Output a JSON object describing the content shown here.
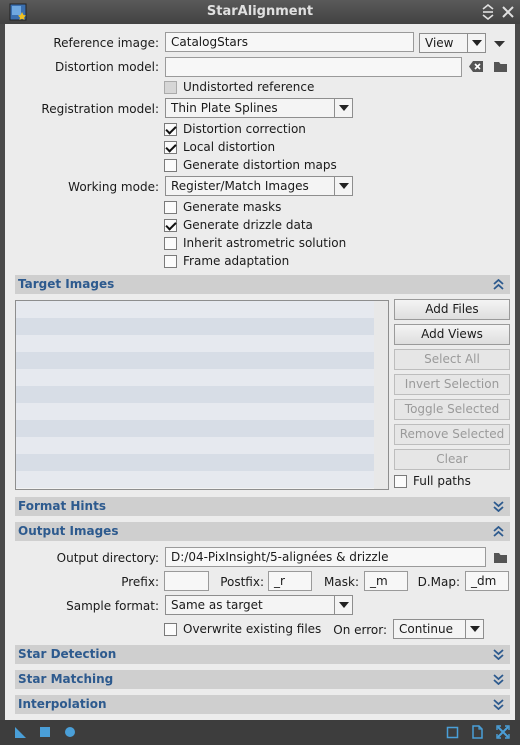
{
  "window": {
    "title": "StarAlignment"
  },
  "reference": {
    "label": "Reference image:",
    "value": "CatalogStars",
    "view_option": "View",
    "distortion_label": "Distortion model:",
    "distortion_value": "",
    "undistorted_label": "Undistorted reference"
  },
  "registration": {
    "label": "Registration model:",
    "value": "Thin Plate Splines",
    "distortion_correction": "Distortion correction",
    "local_distortion": "Local distortion",
    "generate_distortion_maps": "Generate distortion maps"
  },
  "working": {
    "label": "Working mode:",
    "value": "Register/Match Images",
    "generate_masks": "Generate masks",
    "generate_drizzle": "Generate drizzle data",
    "inherit_astrometric": "Inherit astrometric solution",
    "frame_adaptation": "Frame adaptation"
  },
  "targets": {
    "title": "Target Images",
    "buttons": [
      "Add Files",
      "Add Views",
      "Select All",
      "Invert Selection",
      "Toggle Selected",
      "Remove Selected",
      "Clear"
    ],
    "full_paths": "Full paths"
  },
  "format_hints": {
    "title": "Format Hints"
  },
  "output": {
    "title": "Output Images",
    "dir_label": "Output directory:",
    "dir_value": "D:/04-PixInsight/5-alignées & drizzle",
    "prefix_label": "Prefix:",
    "prefix_value": "",
    "postfix_label": "Postfix:",
    "postfix_value": "_r",
    "mask_label": "Mask:",
    "mask_value": "_m",
    "dmap_label": "D.Map:",
    "dmap_value": "_dm",
    "sample_label": "Sample format:",
    "sample_value": "Same as target",
    "overwrite_label": "Overwrite existing files",
    "onerror_label": "On error:",
    "onerror_value": "Continue"
  },
  "sections": {
    "star_detection": "Star Detection",
    "star_matching": "Star Matching",
    "interpolation": "Interpolation"
  },
  "colors": {
    "section_title": "#2d5a8e",
    "panel_bg": "#ececec",
    "frame_bg": "#4a4a4a",
    "accent_icon": "#4a9fd8"
  }
}
